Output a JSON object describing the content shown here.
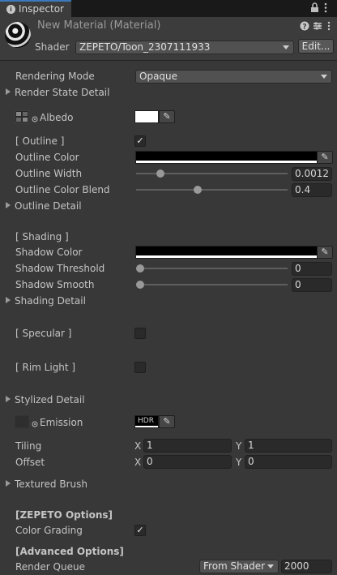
{
  "tab": {
    "label": "Inspector",
    "icon": "info-icon"
  },
  "material": {
    "title": "New Material (Material)",
    "shader_label": "Shader",
    "shader_value": "ZEPETO/Toon_2307111933",
    "edit_button": "Edit..."
  },
  "rendering_mode": {
    "label": "Rendering Mode",
    "value": "Opaque"
  },
  "render_state_detail": "Render State Detail",
  "albedo": {
    "label": "Albedo",
    "color": "#ffffff"
  },
  "outline": {
    "header": "[ Outline ]",
    "checked": true,
    "color_label": "Outline Color",
    "color": "#000000",
    "width_label": "Outline Width",
    "width_value": "0.0012",
    "width_fraction": 0.14,
    "blend_label": "Outline Color Blend",
    "blend_value": "0.4",
    "blend_fraction": 0.4,
    "detail": "Outline Detail"
  },
  "shading": {
    "header": "[ Shading ]",
    "color_label": "Shadow Color",
    "color": "#000000",
    "threshold_label": "Shadow Threshold",
    "threshold_value": "0",
    "threshold_fraction": 0,
    "smooth_label": "Shadow Smooth",
    "smooth_value": "0",
    "smooth_fraction": 0,
    "detail": "Shading Detail"
  },
  "specular": {
    "header": "[ Specular ]",
    "checked": false
  },
  "rim_light": {
    "header": "[ Rim Light ]",
    "checked": false
  },
  "stylized_detail": "Stylized Detail",
  "emission": {
    "label": "Emission",
    "hdr": "HDR"
  },
  "tiling": {
    "label": "Tiling",
    "x_label": "X",
    "x": "1",
    "y_label": "Y",
    "y": "1"
  },
  "offset": {
    "label": "Offset",
    "x_label": "X",
    "x": "0",
    "y_label": "Y",
    "y": "0"
  },
  "textured_brush": "Textured Brush",
  "zepeto_options": {
    "header": "[ZEPETO Options]",
    "color_grading_label": "Color Grading",
    "color_grading_checked": true
  },
  "advanced_options": {
    "header": "[Advanced Options]",
    "render_queue_label": "Render Queue",
    "render_queue_mode": "From Shader",
    "render_queue_value": "2000"
  },
  "icons": {
    "lock": "lock-icon",
    "menu": "kebab-menu-icon",
    "help": "help-icon",
    "settings": "preset-settings-icon",
    "more": "more-icon",
    "picker": "eyedropper-icon"
  }
}
